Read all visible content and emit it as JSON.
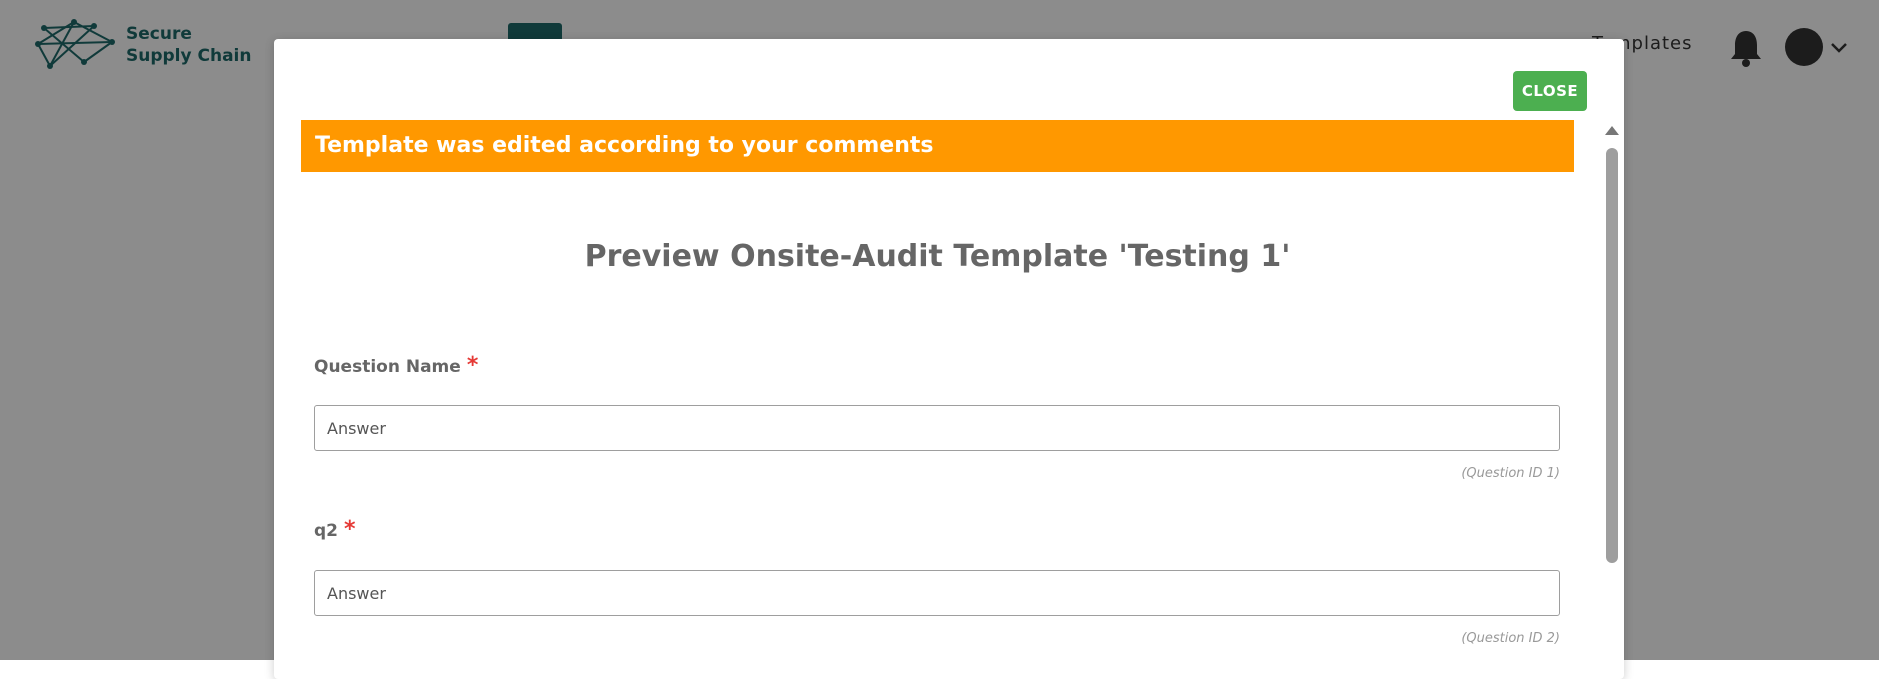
{
  "header": {
    "logo_line1": "Secure",
    "logo_line2": "Supply Chain",
    "nav_visible_link": "Templates"
  },
  "modal": {
    "close_label": "CLOSE",
    "banner_text": "Template was edited according to your comments",
    "title": "Preview Onsite-Audit Template 'Testing 1'",
    "questions": [
      {
        "label": "Question Name",
        "required_mark": "*",
        "placeholder": "Answer",
        "id_text": "(Question ID 1)"
      },
      {
        "label": "q2",
        "required_mark": "*",
        "placeholder": "Answer",
        "id_text": "(Question ID 2)"
      }
    ]
  },
  "colors": {
    "brand": "#1e6b6b",
    "banner": "#ff9800",
    "close_button": "#4caf50",
    "required": "#e53935"
  },
  "icons": [
    "network-logo-icon",
    "bell-icon",
    "avatar-icon",
    "chevron-down-icon",
    "scroll-up-arrow-icon"
  ]
}
